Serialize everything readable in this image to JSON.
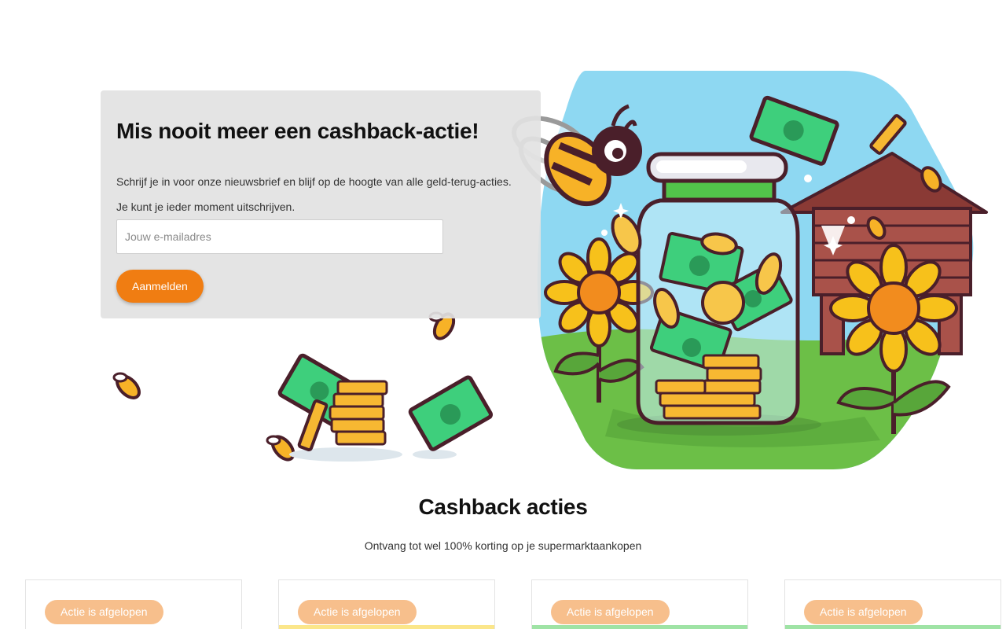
{
  "signup": {
    "title": "Mis nooit meer een cashback-actie!",
    "text_1": "Schrijf je in voor onze nieuwsbrief en blijf op de hoogte van alle geld-terug-acties.",
    "text_2": "Je kunt je ieder moment uitschrijven.",
    "email_placeholder": "Jouw e-mailadres",
    "email_value": "",
    "submit_label": "Aanmelden"
  },
  "deals_section": {
    "title": "Cashback acties",
    "subtitle": "Ontvang tot wel 100% korting op je supermarktaankopen"
  },
  "deals": [
    {
      "badge": "Actie is afgelopen"
    },
    {
      "badge": "Actie is afgelopen"
    },
    {
      "badge": "Actie is afgelopen"
    },
    {
      "badge": "Actie is afgelopen"
    }
  ],
  "colors": {
    "accent": "#f07d12",
    "badge_expired": "#f7bf8c",
    "sky": "#8ed8f2",
    "grass": "#6cbf47",
    "money_green": "#3ecf7c",
    "coin_gold": "#f7b832",
    "outline": "#4a1f2a"
  }
}
